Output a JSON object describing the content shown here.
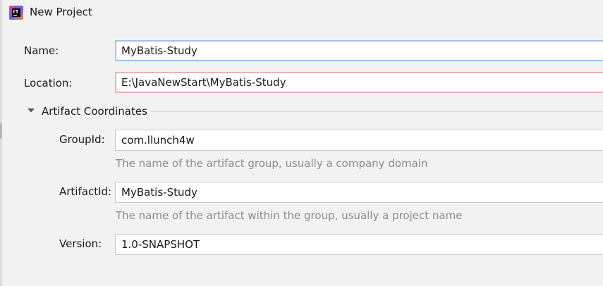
{
  "window": {
    "title": "New Project",
    "icon": "intellij-idea-icon"
  },
  "form": {
    "name": {
      "label": "Name:",
      "value": "MyBatis-Study"
    },
    "location": {
      "label": "Location:",
      "value": "E:\\JavaNewStart\\MyBatis-Study"
    },
    "artifact_section": {
      "title": "Artifact Coordinates",
      "expanded": true,
      "toggle_icon": "triangle-down-icon",
      "group_id": {
        "label": "GroupId:",
        "value": "com.llunch4w",
        "hint": "The name of the artifact group, usually a company domain"
      },
      "artifact_id": {
        "label": "ArtifactId:",
        "value": "MyBatis-Study",
        "hint": "The name of the artifact within the group, usually a project name"
      },
      "version": {
        "label": "Version:",
        "value": "1.0-SNAPSHOT"
      }
    }
  },
  "colors": {
    "background": "#f2f2f2",
    "focus_border": "#9ec4ea",
    "error_border": "#e8b3b3",
    "hint_text": "#8a8a8a"
  }
}
